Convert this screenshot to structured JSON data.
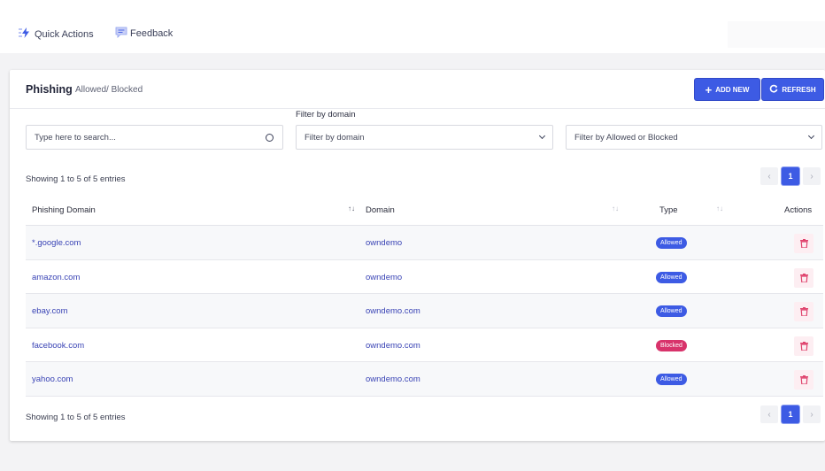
{
  "topbar": {
    "quick_actions": "Quick Actions",
    "feedback": "Feedback"
  },
  "header": {
    "title": "Phishing",
    "subtitle": "Allowed/ Blocked",
    "add_new": "ADD NEW",
    "refresh": "REFRESH"
  },
  "filters": {
    "label": "Filter by domain",
    "search_placeholder": "Type here to search...",
    "domain_select": "Filter by domain",
    "type_select": "Filter by Allowed or Blocked"
  },
  "info": {
    "showing": "Showing 1 to 5 of 5 entries"
  },
  "pagination": {
    "prev": "‹",
    "current": "1",
    "next": "›"
  },
  "table": {
    "headers": {
      "phishing_domain": "Phishing Domain",
      "domain": "Domain",
      "type": "Type",
      "actions": "Actions"
    },
    "rows": [
      {
        "phishing_domain": "*.google.com",
        "domain": "owndemo",
        "type": "Allowed"
      },
      {
        "phishing_domain": "amazon.com",
        "domain": "owndemo",
        "type": "Allowed"
      },
      {
        "phishing_domain": "ebay.com",
        "domain": "owndemo.com",
        "type": "Allowed"
      },
      {
        "phishing_domain": "facebook.com",
        "domain": "owndemo.com",
        "type": "Blocked"
      },
      {
        "phishing_domain": "yahoo.com",
        "domain": "owndemo.com",
        "type": "Allowed"
      }
    ]
  },
  "icons": {
    "quick_actions": "lightning-icon",
    "feedback": "feedback-icon",
    "add": "plus-icon",
    "refresh": "refresh-icon",
    "search": "search-icon",
    "dropdown": "chevron-down-icon",
    "delete": "trash-icon"
  },
  "colors": {
    "primary": "#3d5be4",
    "allowed": "#3d5be4",
    "blocked": "#d8336b",
    "link": "#3a44b5",
    "delete_bg": "#fdeef2",
    "delete_icon": "#e0456f"
  }
}
